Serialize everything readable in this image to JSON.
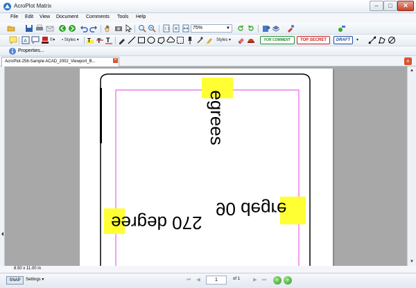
{
  "window": {
    "title": "AcroPlot Matrix"
  },
  "menu": {
    "items": [
      "File",
      "Edit",
      "View",
      "Document",
      "Comments",
      "Tools",
      "Help"
    ]
  },
  "toolbar": {
    "zoom": "75%",
    "styles_label_1": "Styles",
    "styles_label_2": "Styles",
    "stamps": [
      "FOR COMMENT",
      "TOP SECRET",
      "DRAFT"
    ],
    "properties_label": "Properties..."
  },
  "document": {
    "tab_label": "AcroPlot-256-Sample ACAD_2002_Viewport_B...",
    "page_size": "8.50 x 11.00 in",
    "drawing_texts": {
      "top_rotated": "egrees",
      "middle_right": "90 degre",
      "middle_left": "270 degree"
    },
    "colors": {
      "workspace": "#a8a8a8",
      "magenta_border": "#e040e0",
      "highlight": "#ffff33"
    }
  },
  "statusbar": {
    "snap_label": "SNAP",
    "settings_label": "Settings",
    "current_page": "1",
    "of_label": "of 1"
  }
}
